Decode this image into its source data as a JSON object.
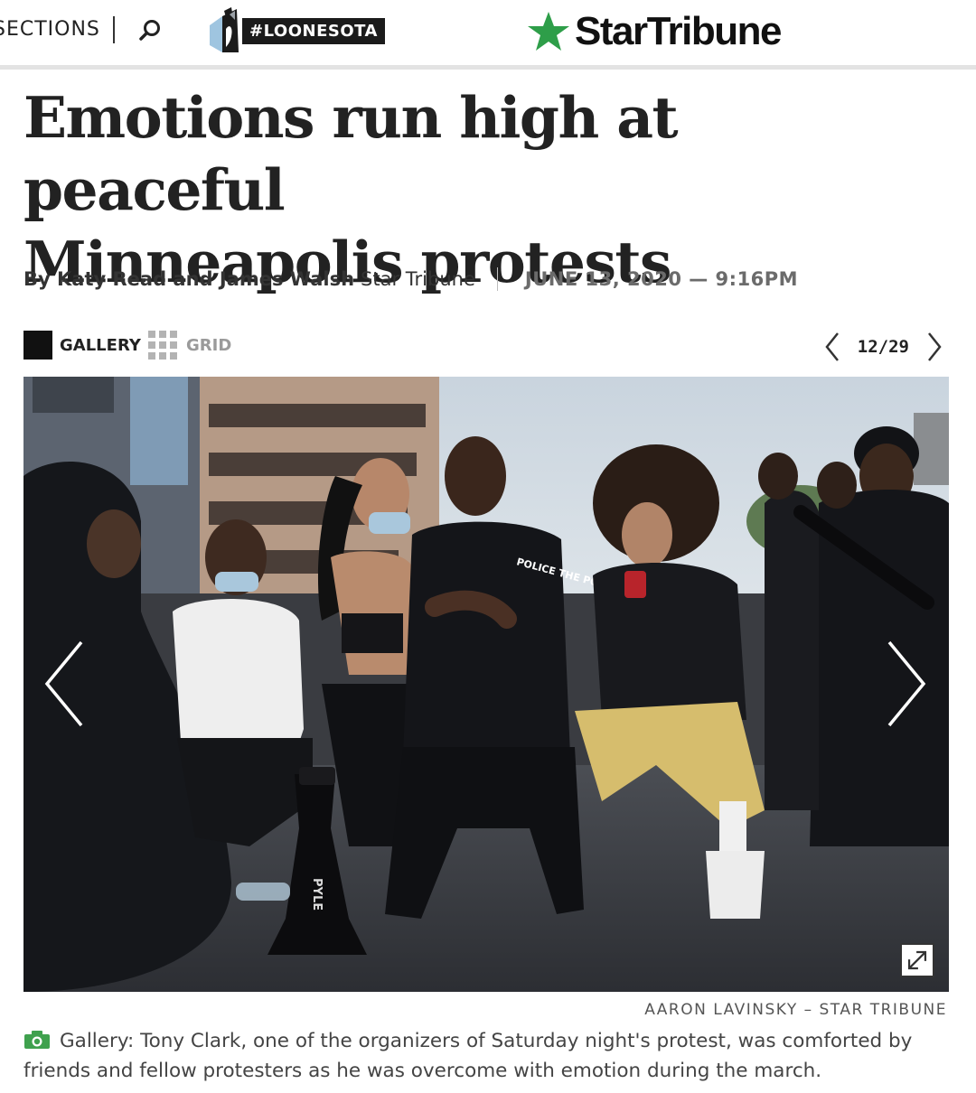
{
  "nav": {
    "sections_label": "SECTIONS",
    "promo_badge": "#LOONESOTA",
    "brand": "StarTribune",
    "colors": {
      "brand_star": "#2e9e49",
      "badge_bg": "#1b1b1b"
    }
  },
  "article": {
    "headline_line1": "Emotions run high at peaceful",
    "headline_line2": "Minneapolis protests",
    "byline_authors": "By Katy Read and James Walsh",
    "byline_outlet": "Star Tribune",
    "dateline": "JUNE 13, 2020 — 9:16PM"
  },
  "gallery": {
    "gallery_label": "GALLERY",
    "grid_label": "GRID",
    "counter": "12/29",
    "current_index": 12,
    "total": 29,
    "photo_credit": "AARON LAVINSKY – STAR TRIBUNE",
    "caption": "Gallery: Tony Clark, one of the organizers of Saturday night's protest, was comforted by friends and fellow protesters as he was overcome with emotion during the march.",
    "caption_icon": "camera-icon"
  },
  "photo_text": {
    "shirt_text": "POLICE THE POLICE",
    "megaphone_brand": "PYLE"
  }
}
